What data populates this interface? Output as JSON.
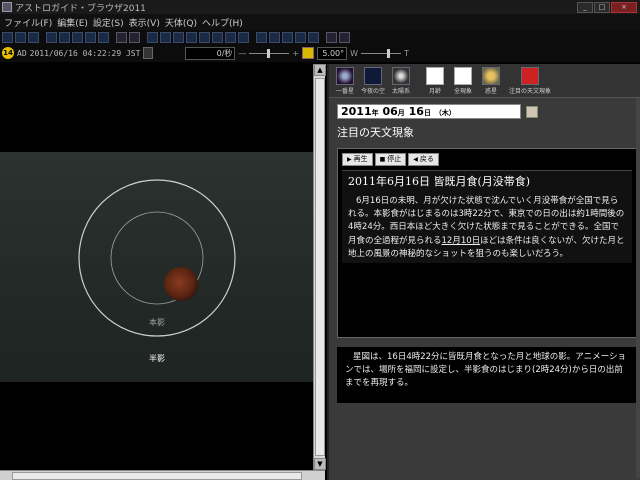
{
  "window": {
    "title": "アストロガイド・ブラウザ2011",
    "controls": {
      "minimize": "_",
      "maximize": "□",
      "close": "×"
    }
  },
  "menu": {
    "items": [
      "ファイル(F)",
      "編集(E)",
      "設定(S)",
      "表示(V)",
      "天体(Q)",
      "ヘルプ(H)"
    ]
  },
  "toolbar": {
    "day_badge": "14",
    "era": "AD",
    "datetime": "2011/06/16 04:22:29 JST",
    "speed": "0/秒",
    "fov": "5.00°",
    "w_label": "W",
    "t_label": "T"
  },
  "sky": {
    "penumbra_label_inner": "本影",
    "penumbra_label_outer": "半影"
  },
  "panel": {
    "tools": [
      {
        "label": "一番星",
        "icon": "star-icon"
      },
      {
        "label": "今夜の空",
        "icon": "night-sky-icon"
      },
      {
        "label": "太陽系",
        "icon": "solar-system-icon"
      },
      {
        "label": "月齢",
        "icon": "moon-age-icon"
      },
      {
        "label": "全現象",
        "icon": "all-events-icon"
      },
      {
        "label": "惑星",
        "icon": "planet-icon"
      },
      {
        "label": "注目の天文現象",
        "icon": "featured-event-icon"
      }
    ],
    "date_year": "2011",
    "date_year_unit": "年",
    "date_month": "06",
    "date_month_unit": "月",
    "date_day": "16",
    "date_day_unit": "日",
    "date_weekday": "（木）",
    "section_title": "注目の天文現象",
    "controls": {
      "play": "再生",
      "stop": "停止",
      "back": "戻る"
    },
    "event_title": "2011年6月16日 皆既月食(月没帯食)",
    "event_body_1": "6月16日の未明、月が欠けた状態で沈んでいく月没帯食が全国で見られる。本影食がはじまるのは3時22分で、東京での日の出は約1時間後の4時24分。西日本ほど大きく欠けた状態まで見ることができる。全国で月食の全過程が見られる",
    "event_body_link": "12月10日",
    "event_body_2": "ほどは条件は良くないが、欠けた月と地上の風景の神秘的なショットを狙うのも楽しいだろう。",
    "description": "星図は、16日4時22分に皆既月食となった月と地球の影。アニメーションでは、場所を福岡に設定し、半影食のはじまり(2時24分)から日の出前までを再現する。"
  },
  "colors": {
    "accent_yellow": "#e8c000",
    "moon": "#8a3a1e",
    "panel_bg": "#3a3a3a"
  }
}
